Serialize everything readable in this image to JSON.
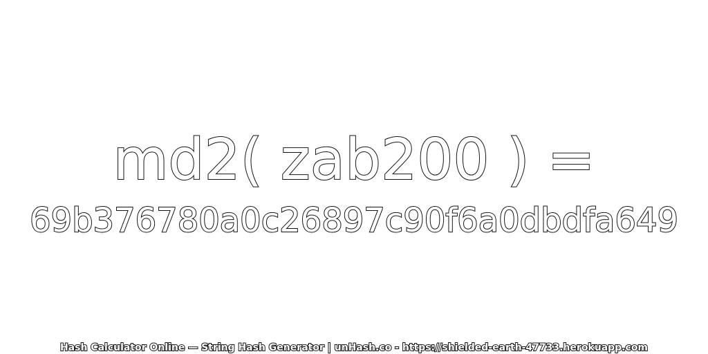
{
  "main": {
    "expression": "md2( zab200 ) =",
    "hash": "69b376780a0c26897c90f6a0dbdfa649"
  },
  "footer": {
    "text": "Hash Calculator Online — String Hash Generator | unHash.co - https://shielded-earth-47733.herokuapp.com"
  }
}
